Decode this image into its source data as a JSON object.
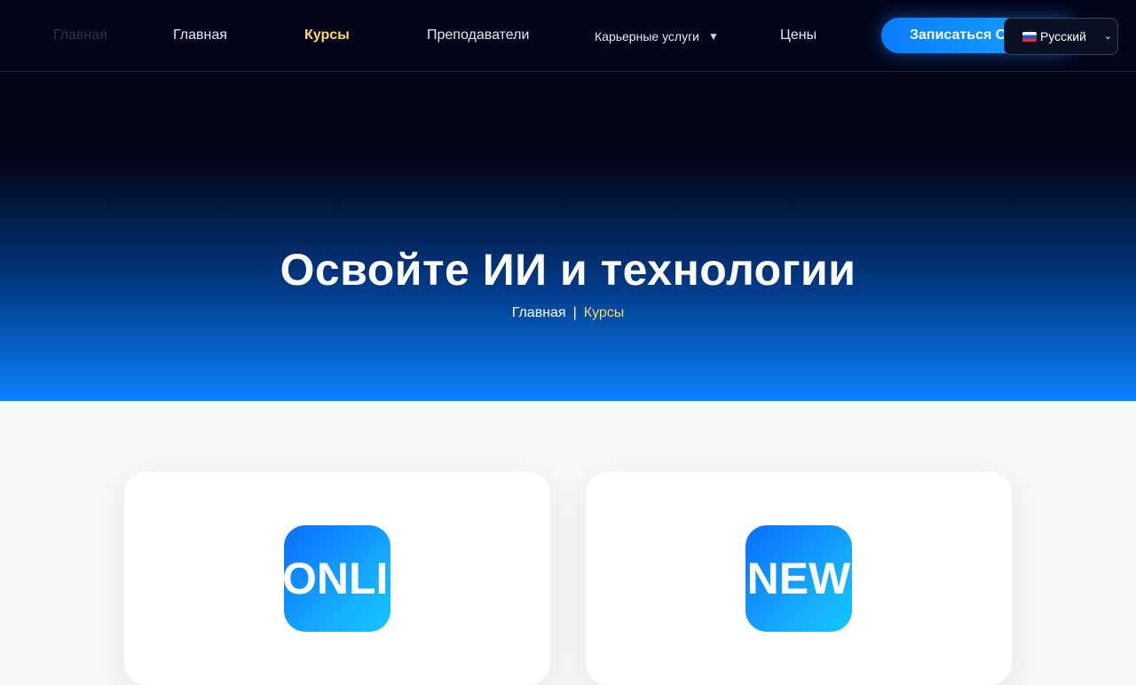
{
  "nav": {
    "logo_text": "Главная",
    "items": [
      {
        "label": "Главная"
      },
      {
        "label": "Курсы"
      },
      {
        "label": "Преподаватели"
      },
      {
        "label": "Карьерные услуги"
      },
      {
        "label": "Цены"
      }
    ],
    "dropdown_caret": "▼",
    "cta_label": "Записаться Сейчас",
    "language": {
      "selected": "Русский",
      "chevron": "⌄"
    },
    "active_item": "Курсы"
  },
  "hero": {
    "title": "Освойте ИИ и технологии",
    "breadcrumb": {
      "home": "Главная",
      "separator": "|",
      "current": "Курсы"
    }
  },
  "cards": [
    {
      "badge": "ONLINE"
    },
    {
      "badge": "NEW"
    }
  ],
  "colors": {
    "nav_bg": "#03061a",
    "accent": "#0a7dff",
    "highlight": "#ffd76a",
    "page_bg": "#f6f8fa"
  },
  "icons": {
    "language_flag": "russia-flag-icon",
    "dropdown": "caret-down-icon"
  }
}
